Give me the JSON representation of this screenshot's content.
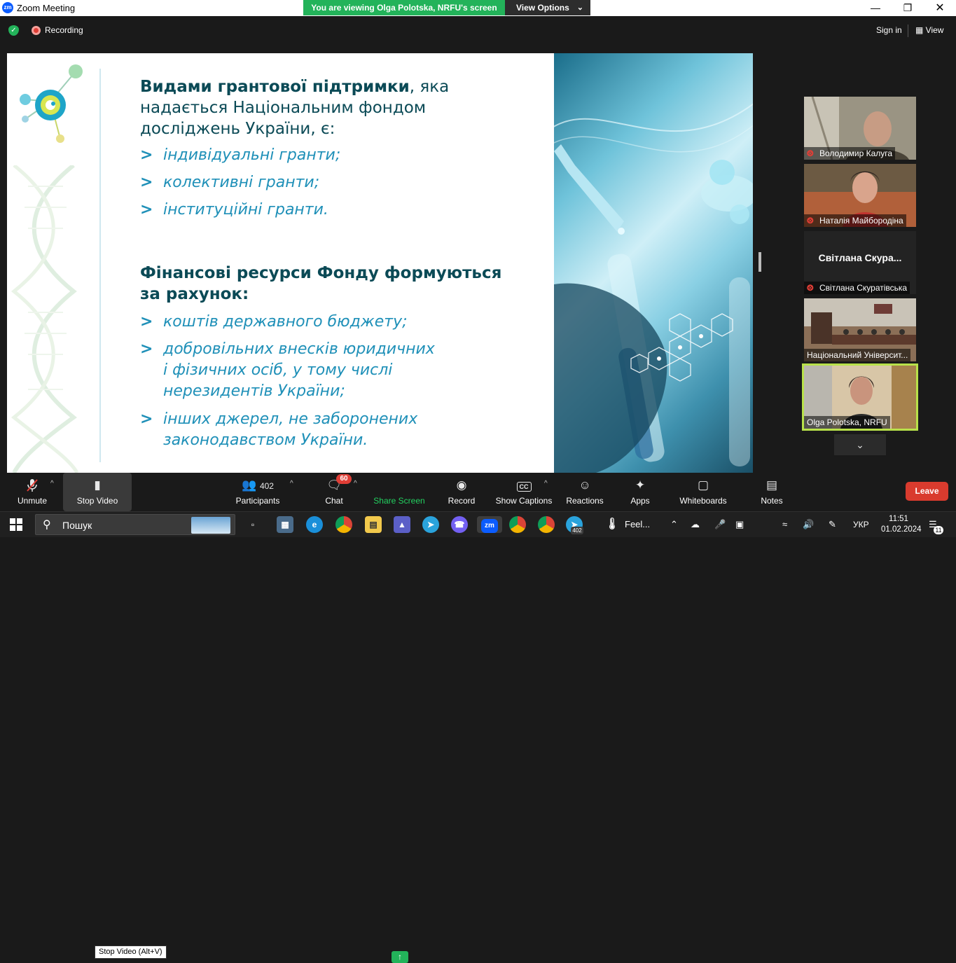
{
  "window": {
    "app_logo": "zm",
    "title": "Zoom Meeting",
    "controls": [
      "minimize-icon",
      "maximize-icon",
      "close-icon"
    ]
  },
  "share_banner": {
    "message": "You are viewing Olga Polotska, NRFU's screen",
    "options_label": "View Options"
  },
  "topbar": {
    "recording_label": "Recording",
    "signin_label": "Sign in",
    "view_label": "View"
  },
  "slide": {
    "heading1_bold": "Видами грантової підтримки",
    "heading1_rest": ", яка",
    "heading1_line2": "надається Національним фондом",
    "heading1_line3": "досліджень України, є:",
    "bullets1": [
      "індивідуальні гранти;",
      "колективні гранти;",
      "інституційні гранти."
    ],
    "heading2_line1": "Фінансові ресурси Фонду формуються",
    "heading2_line2": "за рахунок:",
    "bullets2": [
      {
        "lines": [
          "коштів державного бюджету;"
        ]
      },
      {
        "lines": [
          "добровільних внесків юридичних",
          "і фізичних осіб, у тому числі",
          "нерезидентів України;"
        ]
      },
      {
        "lines": [
          "інших джерел, не заборонених",
          "законодавством України."
        ]
      }
    ],
    "bullet_marker": ">",
    "accent_color": "#1f90b8",
    "heading_color": "#0b4a56"
  },
  "participants": [
    {
      "name": "Володимир Калуга",
      "muted": true,
      "video": true
    },
    {
      "name": "Наталія Майбородіна",
      "muted": true,
      "video": true
    },
    {
      "name": "Світлана Скуратівська",
      "display_name": "Світлана  Скура...",
      "muted": true,
      "video": false
    },
    {
      "name": "Національний Університ...",
      "muted": false,
      "video": true
    },
    {
      "name": "Olga Polotska, NRFU",
      "muted": false,
      "video": true,
      "active_speaker": true
    }
  ],
  "toolbar": {
    "unmute": "Unmute",
    "stop_video": "Stop Video",
    "stop_video_tooltip": "Stop Video (Alt+V)",
    "participants_count": "402",
    "participants": "Participants",
    "chat": "Chat",
    "chat_badge": "60",
    "share_screen": "Share Screen",
    "record": "Record",
    "show_captions": "Show Captions",
    "reactions": "Reactions",
    "apps": "Apps",
    "whiteboards": "Whiteboards",
    "notes": "Notes",
    "leave": "Leave"
  },
  "taskbar": {
    "search_label": "Пошук",
    "weather_label": "Feel...",
    "language": "УКР",
    "time": "11:51",
    "date": "01.02.2024",
    "notification_count": "11",
    "telegram_badge": "402",
    "zoom_label": "zm"
  }
}
